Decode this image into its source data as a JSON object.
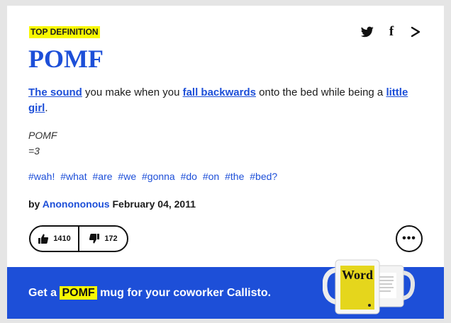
{
  "badge": "TOP DEFINITION",
  "word": "POMF",
  "meaning": {
    "link1": "The sound",
    "text1": " you make when you ",
    "link2": "fall backwards",
    "text2": " onto the bed while being a ",
    "link3": "little girl",
    "text3": "."
  },
  "example": {
    "line1": "POMF",
    "line2": "=3"
  },
  "tags": [
    "#wah!",
    "#what",
    "#are",
    "#we",
    "#gonna",
    "#do",
    "#on",
    "#the",
    "#bed?"
  ],
  "byline": {
    "prefix": "by ",
    "author": "Anonononous",
    "date": " February 04, 2011"
  },
  "votes": {
    "up": "1410",
    "down": "172"
  },
  "more_label": "•••",
  "promo": {
    "pre": "Get a ",
    "word": "POMF",
    "post": " mug for your coworker Callisto.",
    "mug_label": "Word"
  },
  "icons": {
    "share_twitter": "twitter-icon",
    "share_facebook": "facebook-icon",
    "share_more": "share-icon",
    "thumbs_up": "thumbs-up-icon",
    "thumbs_down": "thumbs-down-icon"
  },
  "colors": {
    "link_blue": "#1d4fd8",
    "highlight_yellow": "#f8f800",
    "promo_blue": "#1d4fd8"
  }
}
